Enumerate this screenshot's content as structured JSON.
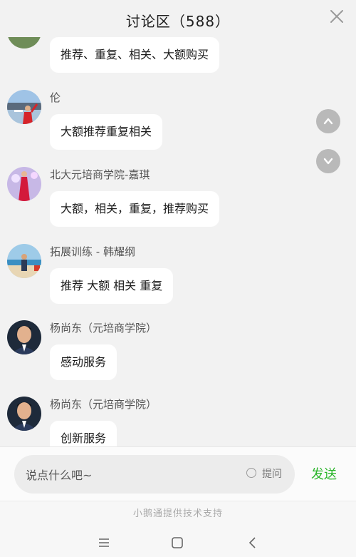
{
  "header": {
    "title": "讨论区（588）"
  },
  "messages": [
    {
      "name": "",
      "text": "推荐、重复、相关、大额购买",
      "avatar": "avatar-field"
    },
    {
      "name": "伦",
      "text": "大额推荐重复相关",
      "avatar": "avatar-waterfront"
    },
    {
      "name": "北大元培商学院-嘉琪",
      "text": "大额，相关，重复，推荐购买",
      "avatar": "avatar-red-dress"
    },
    {
      "name": "拓展训练 - 韩耀纲",
      "text": "推荐 大额 相关 重复",
      "avatar": "avatar-beach"
    },
    {
      "name": "杨尚东（元培商学院）",
      "text": "感动服务",
      "avatar": "avatar-man-suit"
    },
    {
      "name": "杨尚东（元培商学院）",
      "text": "创新服务",
      "avatar": "avatar-man-suit"
    }
  ],
  "scroll": {
    "up_icon": "chevron-up-icon",
    "down_icon": "chevron-down-icon"
  },
  "compose": {
    "placeholder": "说点什么吧~",
    "question_label": "提问",
    "send_label": "发送"
  },
  "footer": {
    "text": "小鹅通提供技术支持"
  },
  "colors": {
    "send": "#2bb52b",
    "background": "#f2f2f2",
    "scroll_button": "#b9b9b9"
  }
}
